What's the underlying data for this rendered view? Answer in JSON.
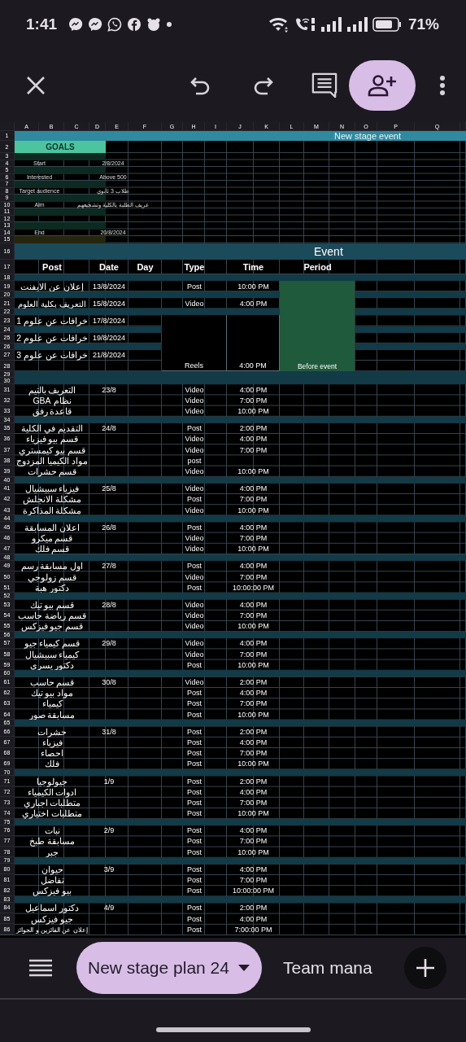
{
  "status_bar": {
    "time": "1:41",
    "battery": "71%"
  },
  "sheet": {
    "column_letters": [
      "A",
      "B",
      "C",
      "D",
      "E",
      "F",
      "G",
      "H",
      "I",
      "J",
      "K",
      "L",
      "M",
      "N",
      "O",
      "P",
      "Q"
    ],
    "rows": [
      {
        "number": "1",
        "kind": "title",
        "text": "New stage event"
      },
      {
        "number": "2",
        "kind": "goals_header",
        "text": "GOALS"
      },
      {
        "number": "3",
        "kind": "goals_blank"
      },
      {
        "number": "4",
        "kind": "goal",
        "label": "Start",
        "value": "2/8/2024"
      },
      {
        "number": "5",
        "kind": "goals_blank"
      },
      {
        "number": "6",
        "kind": "goal",
        "label": "Interested",
        "value": "Above 500"
      },
      {
        "number": "7",
        "kind": "goals_blank"
      },
      {
        "number": "8",
        "kind": "goal",
        "label": "Target audience",
        "value": "طلاب 3 ثانوي"
      },
      {
        "number": "9",
        "kind": "goals_blank"
      },
      {
        "number": "10",
        "kind": "goal",
        "label": "Aim",
        "value": "عريف الطلبة بالكلية وتشجيعهم"
      },
      {
        "number": "11",
        "kind": "goals_blank"
      },
      {
        "number": "12",
        "kind": "goals_empty"
      },
      {
        "number": "13",
        "kind": "goals_blank"
      },
      {
        "number": "14",
        "kind": "goal",
        "label": "End",
        "value": "20/8/2024"
      },
      {
        "number": "15",
        "kind": "goals_footer"
      },
      {
        "number": "16",
        "kind": "section",
        "text": "Event"
      },
      {
        "number": "17",
        "kind": "header",
        "cells": [
          "Post",
          "Date",
          "Day",
          "Type",
          "Time",
          "Period"
        ]
      },
      {
        "number": "18",
        "kind": "separator"
      },
      {
        "kind": "block",
        "period": "Before event",
        "rows": [
          {
            "number": "19",
            "kind": "entry",
            "post": "إعلان عن الايفنت",
            "date": "13/8/2024",
            "type": "Post",
            "time": "10:00 PM"
          },
          {
            "number": "20",
            "kind": "separator"
          },
          {
            "number": "21",
            "kind": "entry",
            "post": "التعريف بكلية العلوم",
            "date": "15/8/2024",
            "type": "Video",
            "time": "4:00 PM"
          },
          {
            "number": "22",
            "kind": "separator"
          },
          {
            "kind": "merged",
            "type": "Reels",
            "time": "4:00 PM",
            "rows": [
              {
                "number": "23",
                "kind": "entry",
                "post": "خرافات عن علوم 1",
                "date": "17/8/2024"
              },
              {
                "number": "24",
                "kind": "separator"
              },
              {
                "number": "25",
                "kind": "entry",
                "post": "خرافات عن علوم 2",
                "date": "19/8/2024"
              },
              {
                "number": "26",
                "kind": "separator"
              },
              {
                "number": "27",
                "kind": "entry",
                "post": "خرافات عن علوم 3",
                "date": "21/8/2024"
              },
              {
                "number": "28",
                "kind": "entry"
              }
            ]
          }
        ]
      },
      {
        "number": "29",
        "kind": "separator"
      },
      {
        "number": "30",
        "kind": "separator"
      },
      {
        "number": "31",
        "kind": "entry",
        "post": "التعريف بالتيم",
        "date": "23/8",
        "type": "Video",
        "time": "4:00 PM"
      },
      {
        "number": "32",
        "kind": "entry",
        "post": "نظام GBA",
        "type": "Video",
        "time": "7:00 PM"
      },
      {
        "number": "33",
        "kind": "entry",
        "post": "قاعدة رفق",
        "type": "Video",
        "time": "10:00 PM"
      },
      {
        "number": "34",
        "kind": "separator"
      },
      {
        "number": "35",
        "kind": "entry",
        "post": "التقديم في الكلية",
        "date": "24/8",
        "type": "Post",
        "time": "2:00 PM"
      },
      {
        "number": "36",
        "kind": "entry",
        "post": "قسم بيو فيزياء",
        "type": "Video",
        "time": "4:00 PM"
      },
      {
        "number": "37",
        "kind": "entry",
        "post": "قسم بيو كيمستري",
        "type": "Video",
        "time": "7:00 PM"
      },
      {
        "number": "38",
        "kind": "entry",
        "post": "مواد الكيميا المزدوج",
        "type": "post"
      },
      {
        "number": "39",
        "kind": "entry",
        "post": "قسم حشرات",
        "type": "Video",
        "time": "10:00 PM"
      },
      {
        "number": "40",
        "kind": "separator"
      },
      {
        "number": "41",
        "kind": "entry",
        "post": "فيزياء سبيشيال",
        "date": "25/8",
        "type": "Video",
        "time": "4:00 PM"
      },
      {
        "number": "42",
        "kind": "entry",
        "post": "مشكلة الانجلش",
        "type": "Post",
        "time": "7:00 PM"
      },
      {
        "number": "43",
        "kind": "entry",
        "post": "مشكلة المذاكرة",
        "type": "Video",
        "time": "10:00 PM"
      },
      {
        "number": "44",
        "kind": "separator"
      },
      {
        "number": "45",
        "kind": "entry",
        "post": "اعلان المسابقة",
        "date": "26/8",
        "type": "Post",
        "time": "4:00 PM"
      },
      {
        "number": "46",
        "kind": "entry",
        "post": "قسم ميكرو",
        "type": "Video",
        "time": "7:00 PM"
      },
      {
        "number": "47",
        "kind": "entry",
        "post": "قسم فلك",
        "type": "Video",
        "time": "10:00 PM"
      },
      {
        "number": "48",
        "kind": "separator"
      },
      {
        "number": "49",
        "kind": "entry",
        "post": "اول مسابقة رسم",
        "date": "27/8",
        "type": "Post",
        "time": "4:00 PM"
      },
      {
        "number": "50",
        "kind": "entry",
        "post": "قسم زولوجي",
        "type": "Video",
        "time": "7:00 PM"
      },
      {
        "number": "51",
        "kind": "entry",
        "post": "دكتور هبة",
        "type": "Post",
        "time": "10:00:00 PM"
      },
      {
        "number": "52",
        "kind": "separator"
      },
      {
        "number": "53",
        "kind": "entry",
        "post": "قسم بيو تيك",
        "date": "28/8",
        "type": "Video",
        "time": "4:00 PM"
      },
      {
        "number": "54",
        "kind": "entry",
        "post": "قسم رياضة حاسب",
        "type": "Video",
        "time": "7:00 PM"
      },
      {
        "number": "55",
        "kind": "entry",
        "post": "قسم جيو فيزكس",
        "type": "Video",
        "time": "10:00 PM"
      },
      {
        "number": "56",
        "kind": "separator"
      },
      {
        "number": "57",
        "kind": "entry",
        "post": "قسم كيمياء جيو",
        "date": "29/8",
        "type": "Video",
        "time": "4:00 PM"
      },
      {
        "number": "58",
        "kind": "entry",
        "post": "كيمياء سبيشيال",
        "type": "Video",
        "time": "7:00 PM"
      },
      {
        "number": "59",
        "kind": "entry",
        "post": "دكتور يسري",
        "type": "Post",
        "time": "10:00 PM"
      },
      {
        "number": "60",
        "kind": "separator"
      },
      {
        "number": "61",
        "kind": "entry",
        "post": "قسم حاسب",
        "date": "30/8",
        "type": "Video",
        "time": "2:00 PM"
      },
      {
        "number": "62",
        "kind": "entry",
        "post": "مواد بيو تيك",
        "type": "Post",
        "time": "4:00 PM"
      },
      {
        "number": "63",
        "kind": "entry",
        "post": "كيمياء",
        "type": "Post",
        "time": "7:00 PM"
      },
      {
        "number": "64",
        "kind": "entry",
        "post": "مسابقة صور",
        "type": "Post",
        "time": "10:00 PM"
      },
      {
        "number": "65",
        "kind": "separator"
      },
      {
        "number": "66",
        "kind": "entry",
        "post": "حشرات",
        "date": "31/8",
        "type": "Post",
        "time": "2:00 PM"
      },
      {
        "number": "67",
        "kind": "entry",
        "post": "فيزياء",
        "type": "Post",
        "time": "4:00 PM"
      },
      {
        "number": "68",
        "kind": "entry",
        "post": "احصاء",
        "type": "Post",
        "time": "7:00 PM"
      },
      {
        "number": "69",
        "kind": "entry",
        "post": "فلك",
        "type": "Post",
        "time": "10:00 PM"
      },
      {
        "number": "70",
        "kind": "separator"
      },
      {
        "number": "71",
        "kind": "entry",
        "post": "جيولوجيا",
        "date": "1/9",
        "type": "Post",
        "time": "2:00 PM"
      },
      {
        "number": "72",
        "kind": "entry",
        "post": "ادوات الكيمياء",
        "type": "Post",
        "time": "4:00 PM"
      },
      {
        "number": "73",
        "kind": "entry",
        "post": "متطلبات اجباري",
        "type": "Post",
        "time": "7:00 PM"
      },
      {
        "number": "74",
        "kind": "entry",
        "post": "متطلبات اختياري",
        "type": "Post",
        "time": "10:00 PM"
      },
      {
        "number": "75",
        "kind": "separator"
      },
      {
        "number": "76",
        "kind": "entry",
        "post": "نبات",
        "date": "2/9",
        "type": "Post",
        "time": "4:00 PM"
      },
      {
        "number": "77",
        "kind": "entry",
        "post": "مسابقة طبخ",
        "type": "Post",
        "time": "7:00 PM"
      },
      {
        "number": "78",
        "kind": "entry",
        "post": "جبر",
        "type": "Post",
        "time": "10:00 PM"
      },
      {
        "number": "79",
        "kind": "separator"
      },
      {
        "number": "80",
        "kind": "entry",
        "post": "حيوان",
        "date": "3/9",
        "type": "Post",
        "time": "4:00 PM"
      },
      {
        "number": "81",
        "kind": "entry",
        "post": "تفاضل",
        "type": "Post",
        "time": "7:00 PM"
      },
      {
        "number": "82",
        "kind": "entry",
        "post": "بيو فيزكس",
        "type": "Post",
        "time": "10:00:00 PM"
      },
      {
        "number": "83",
        "kind": "separator"
      },
      {
        "number": "84",
        "kind": "entry",
        "post": "دكتور اسماعيل",
        "date": "4/9",
        "type": "Post",
        "time": "2:00 PM"
      },
      {
        "number": "85",
        "kind": "entry",
        "post": "جيو فيزكس",
        "type": "Post",
        "time": "4:00 PM"
      },
      {
        "number": "86",
        "kind": "entry",
        "post": "إعلان عن الفائزين و الجوائز",
        "type": "Post",
        "time": "7:00:00 PM"
      }
    ]
  },
  "sheet_tabs": {
    "tabs": [
      {
        "label": "New stage plan 24",
        "selected": true
      },
      {
        "label": "Team mana",
        "selected": false
      }
    ]
  }
}
